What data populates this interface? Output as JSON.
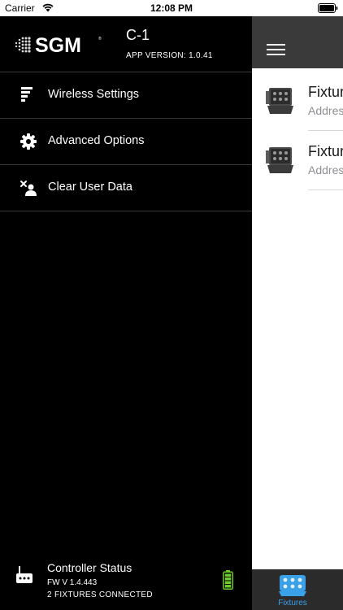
{
  "status_bar": {
    "carrier": "Carrier",
    "time": "12:08 PM"
  },
  "drawer": {
    "logo_text": "SGM",
    "app_name": "C-1",
    "app_version": "APP VERSION: 1.0.41",
    "menu": [
      {
        "label": "Wireless Settings",
        "icon": "wireless-settings-icon"
      },
      {
        "label": "Advanced Options",
        "icon": "gear-icon"
      },
      {
        "label": "Clear User Data",
        "icon": "clear-user-icon"
      }
    ],
    "controller": {
      "title": "Controller Status",
      "firmware": "FW V 1.4.443",
      "fixtures_connected": "2 FIXTURES CONNECTED",
      "battery_status": "full",
      "battery_color": "#6ccb2b"
    }
  },
  "main": {
    "fixtures": [
      {
        "name": "Fixtur",
        "subtitle": "Addres"
      },
      {
        "name": "Fixtur",
        "subtitle": "Addres"
      }
    ],
    "tabbar": {
      "active_tab": "Fixtures",
      "accent_color": "#3aa0e8"
    }
  }
}
